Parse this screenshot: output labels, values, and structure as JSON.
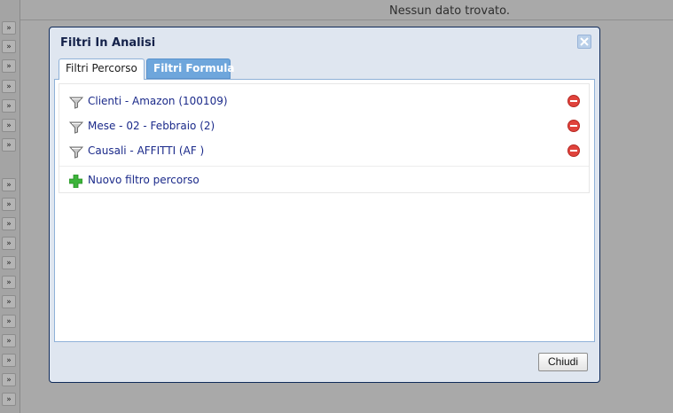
{
  "background": {
    "status_text": "Nessun dato trovato.",
    "expander_glyph": "»"
  },
  "dialog": {
    "title": "Filtri In Analisi",
    "close_icon": "close-icon",
    "tabs": [
      {
        "label": "Filtri Percorso",
        "active": true
      },
      {
        "label": "Filtri Formula",
        "active": false
      }
    ],
    "filters": [
      {
        "label": "Clienti - Amazon (100109)"
      },
      {
        "label": "Mese - 02 - Febbraio (2)"
      },
      {
        "label": "Causali - AFFITTI (AF )"
      }
    ],
    "add_filter_label": "Nuovo filtro percorso",
    "close_button_label": "Chiudi"
  },
  "colors": {
    "dialog_border": "#0f2a59",
    "tab_inactive": "#6ea6dc",
    "link_text": "#1b2a8a",
    "remove_red": "#e0433c",
    "add_green": "#3cb33a"
  }
}
